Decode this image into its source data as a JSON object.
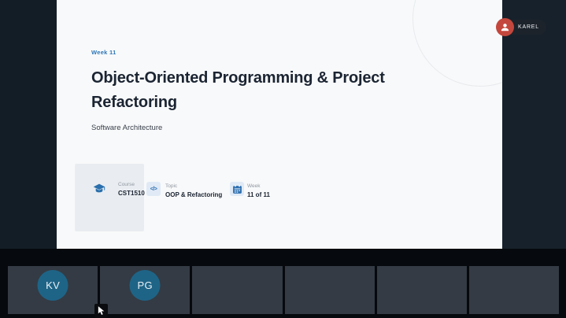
{
  "slide": {
    "kicker": "Week 11",
    "title_line1": "Object-Oriented Programming & Project",
    "title_line2": "Refactoring",
    "subtitle": "Software Architecture",
    "info_items": [
      {
        "icon": "graduation-cap-icon",
        "label": "Course",
        "value": "CST1510"
      },
      {
        "icon": "code-icon",
        "glyph": "</>",
        "label": "Topic",
        "value": "OOP & Refactoring"
      },
      {
        "icon": "calendar-icon",
        "label": "Week",
        "value": "11 of 11"
      }
    ]
  },
  "presenter": {
    "name": "KAREL",
    "avatar_color": "#c4473d"
  },
  "participants": [
    {
      "initials": "KV"
    },
    {
      "initials": "PG"
    }
  ],
  "colors": {
    "accent_blue": "#2d77b8",
    "icon_blue": "#2d6fb0",
    "participant_avatar_teal": "#1e6487",
    "stage_dark_left": "#131d26",
    "stage_dark_right": "#17212b",
    "slide_background": "#f8f9fa",
    "tile_gray": "#343b44"
  }
}
